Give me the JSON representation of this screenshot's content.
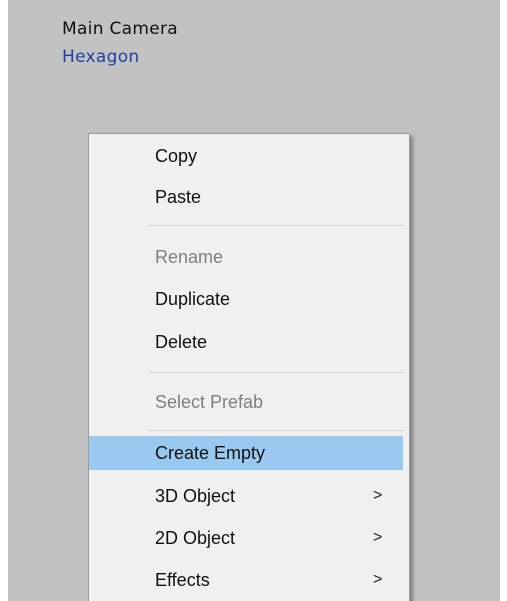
{
  "hierarchy": {
    "items": [
      {
        "label": "Main Camera"
      },
      {
        "label": "Hexagon"
      }
    ]
  },
  "context_menu": {
    "items": [
      {
        "label": "Copy",
        "enabled": true
      },
      {
        "label": "Paste",
        "enabled": true
      },
      {
        "label": "Rename",
        "enabled": false
      },
      {
        "label": "Duplicate",
        "enabled": true
      },
      {
        "label": "Delete",
        "enabled": true
      },
      {
        "label": "Select Prefab",
        "enabled": false
      },
      {
        "label": "Create Empty",
        "enabled": true,
        "highlighted": true
      },
      {
        "label": "3D Object",
        "enabled": true,
        "submenu": true
      },
      {
        "label": "2D Object",
        "enabled": true,
        "submenu": true
      },
      {
        "label": "Effects",
        "enabled": true,
        "submenu": true
      }
    ],
    "submenu_indicator": ">",
    "highlight_color": "#99c9ef",
    "disabled_text_color": "#7f7f7f"
  },
  "colors": {
    "panel_background": "#c2c2c2",
    "menu_background": "#f0f0f0",
    "selected_item_text": "#1e3fa6"
  }
}
